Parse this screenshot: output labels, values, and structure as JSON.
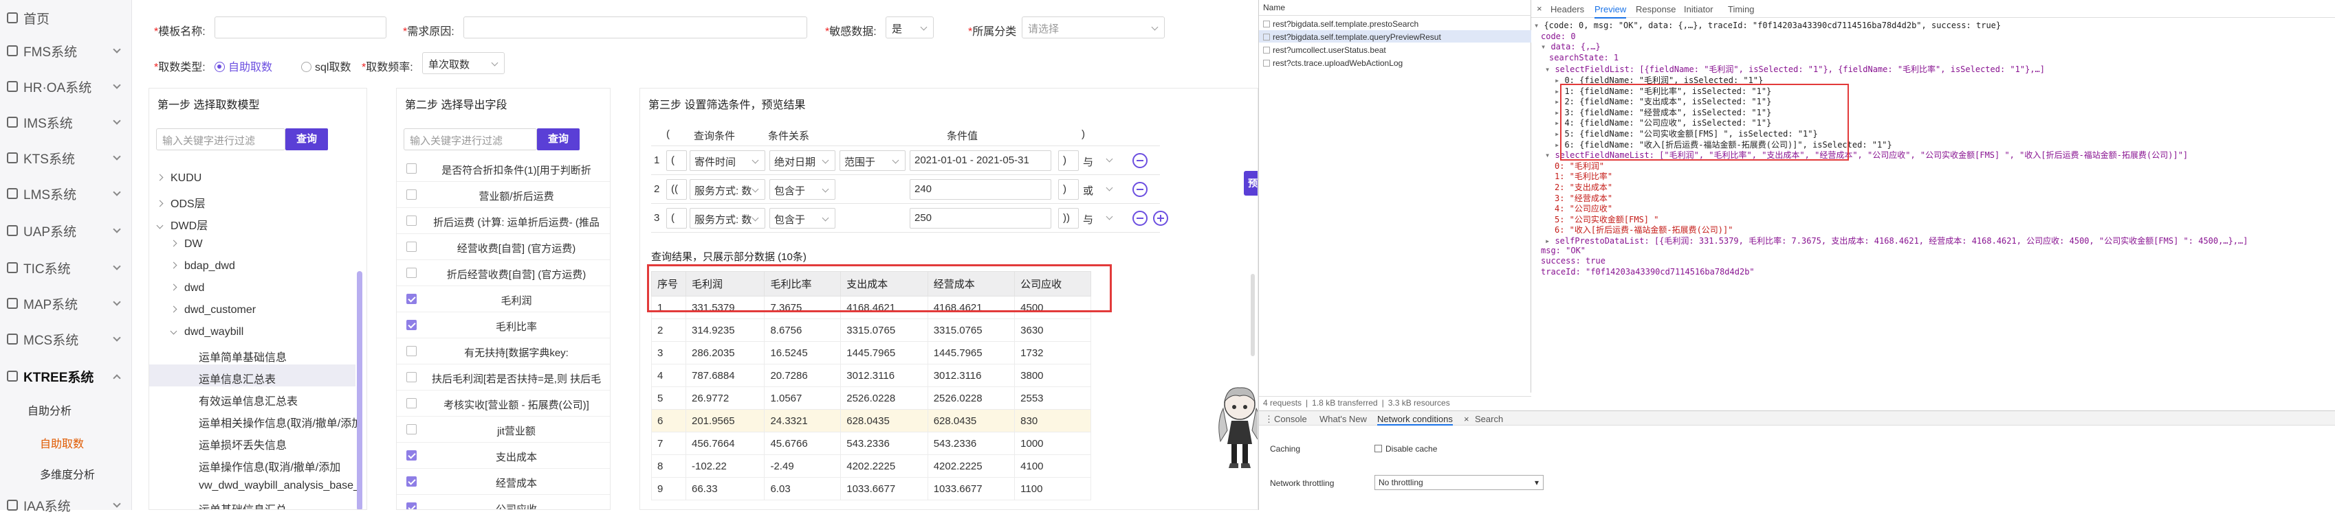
{
  "sidebar": {
    "items": [
      {
        "label": "首页",
        "icon": "home-icon"
      },
      {
        "label": "FMS系统",
        "icon": "module-icon"
      },
      {
        "label": "HR·OA系统",
        "icon": "module-icon"
      },
      {
        "label": "IMS系统",
        "icon": "module-icon"
      },
      {
        "label": "KTS系统",
        "icon": "module-icon"
      },
      {
        "label": "LMS系统",
        "icon": "module-icon"
      },
      {
        "label": "UAP系统",
        "icon": "module-icon"
      },
      {
        "label": "TIC系统",
        "icon": "module-icon"
      },
      {
        "label": "MAP系统",
        "icon": "module-icon"
      },
      {
        "label": "MCS系统",
        "icon": "module-icon"
      },
      {
        "label": "KTREE系统",
        "icon": "module-icon"
      },
      {
        "label": "IAA系统",
        "icon": "module-icon"
      }
    ],
    "sub_items": [
      "自助分析",
      "自助取数",
      "多维度分析"
    ]
  },
  "form": {
    "template_name_label": "模板名称:",
    "demand_reason_label": "需求原因:",
    "sensitive_label": "敏感数据:",
    "sensitive_value": "是",
    "category_label": "所属分类",
    "category_placeholder": "请选择",
    "type_label": "取数类型:",
    "type_option_auto": "自助取数",
    "type_option_sql": "sql取数",
    "freq_label": "取数频率:",
    "freq_value": "单次取数"
  },
  "step1": {
    "title": "第一步 选择取数模型",
    "search_placeholder": "输入关键字进行过滤",
    "search_button": "查询",
    "tree": [
      "KUDU",
      "ODS层",
      "DWD层",
      "DW",
      "bdap_dwd",
      "dwd",
      "dwd_customer",
      "dwd_waybill",
      "运单简单基础信息",
      "运单信息汇总表",
      "有效运单信息汇总表",
      "运单相关操作信息(取消/撤单/添加",
      "运单损坏丢失信息",
      "运单操作信息(取消/撤单/添加",
      "vw_dwd_waybill_analysis_base_t",
      "运单基础信息汇总"
    ]
  },
  "step2": {
    "title": "第二步 选择导出字段",
    "search_placeholder": "输入关键字进行过滤",
    "search_button": "查询",
    "fields": [
      {
        "label": "是否符合折扣条件(1)[用于判断折",
        "checked": false
      },
      {
        "label": "营业额/折后运费",
        "checked": false
      },
      {
        "label": "折后运费 (计算: 运单折后运费- (推品",
        "checked": false
      },
      {
        "label": "经营收费[自营] (官方运费)",
        "checked": false
      },
      {
        "label": "折后经营收费[自营] (官方运费)",
        "checked": false
      },
      {
        "label": "毛利润",
        "checked": true
      },
      {
        "label": "毛利比率",
        "checked": true
      },
      {
        "label": "有无扶持[数据字典key:",
        "checked": false
      },
      {
        "label": "扶后毛利润[若是否扶持=是,则 扶后毛",
        "checked": false
      },
      {
        "label": "考核实收[营业额 - 拓展费(公司)]",
        "checked": false
      },
      {
        "label": "jit营业额",
        "checked": false
      },
      {
        "label": "支出成本",
        "checked": true
      },
      {
        "label": "经营成本",
        "checked": true
      },
      {
        "label": "公司应收",
        "checked": true
      }
    ]
  },
  "step3": {
    "title": "第三步 设置筛选条件，预览结果",
    "headers": [
      "(",
      "查询条件",
      "条件关系",
      "条件值",
      ")"
    ],
    "preview_button": "预览",
    "rows": [
      {
        "num": "1",
        "open": "(",
        "field": "寄件时间",
        "rel": "绝对日期",
        "op": "范围于",
        "value": "2021-01-01 - 2021-05-31",
        "close": ")",
        "logic": "与"
      },
      {
        "num": "2",
        "open": "((",
        "field": "服务方式: 数",
        "rel": "包含于",
        "op": "",
        "value": "240",
        "close": ")",
        "logic": "或"
      },
      {
        "num": "3",
        "open": "(",
        "field": "服务方式: 数",
        "rel": "包含于",
        "op": "",
        "value": "250",
        "close": "))",
        "logic": "与"
      }
    ],
    "result_caption": "查询结果，只展示部分数据 (10条)",
    "columns": [
      "序号",
      "毛利润",
      "毛利比率",
      "支出成本",
      "经营成本",
      "公司应收"
    ],
    "result_rows": [
      [
        "1",
        "331.5379",
        "7.3675",
        "4168.4621",
        "4168.4621",
        "4500"
      ],
      [
        "2",
        "314.9235",
        "8.6756",
        "3315.0765",
        "3315.0765",
        "3630"
      ],
      [
        "3",
        "286.2035",
        "16.5245",
        "1445.7965",
        "1445.7965",
        "1732"
      ],
      [
        "4",
        "787.6884",
        "20.7286",
        "3012.3116",
        "3012.3116",
        "3800"
      ],
      [
        "5",
        "26.9772",
        "1.0567",
        "2526.0228",
        "2526.0228",
        "2553"
      ],
      [
        "6",
        "201.9565",
        "24.3321",
        "628.0435",
        "628.0435",
        "830"
      ],
      [
        "7",
        "456.7664",
        "45.6766",
        "543.2336",
        "543.2336",
        "1000"
      ],
      [
        "8",
        "-102.22",
        "-2.49",
        "4202.2225",
        "4202.2225",
        "4100"
      ],
      [
        "9",
        "66.33",
        "6.03",
        "1033.6677",
        "1033.6677",
        "1100"
      ]
    ]
  },
  "devtools": {
    "name_header": "Name",
    "requests": [
      "rest?bigdata.self.template.prestoSearch",
      "rest?bigdata.self.template.queryPreviewResut",
      "rest?umcollect.userStatus.beat",
      "rest?cts.trace.uploadWebActionLog"
    ],
    "tabs": [
      "Headers",
      "Preview",
      "Response",
      "Initiator",
      "Timing"
    ],
    "active_tab": "Preview",
    "footer": [
      "4 requests",
      "1.8 kB transferred",
      "3.3 kB resources"
    ],
    "drawer_tabs": [
      "Console",
      "What's New",
      "Network conditions",
      "Search"
    ],
    "caching_label": "Caching",
    "disable_cache_label": "Disable cache",
    "throttling_label": "Network throttling",
    "throttling_value": "No throttling",
    "preview_lines": [
      "{code: 0, msg: \"OK\", data: {,…}, traceId: \"f0f14203a43390cd7114516ba78d4d2b\", success: true}",
      "code: 0",
      "data: {,…}",
      "searchState: 1",
      "selectFieldList: [{fieldName: \"毛利润\", isSelected: \"1\"}, {fieldName: \"毛利比率\", isSelected: \"1\"},…]",
      "0: {fieldName: \"毛利润\", isSelected: \"1\"}",
      "1: {fieldName: \"毛利比率\", isSelected: \"1\"}",
      "2: {fieldName: \"支出成本\", isSelected: \"1\"}",
      "3: {fieldName: \"经营成本\", isSelected: \"1\"}",
      "4: {fieldName: \"公司应收\", isSelected: \"1\"}",
      "5: {fieldName: \"公司实收金额[FMS] \", isSelected: \"1\"}",
      "6: {fieldName: \"收入[折后运费-福站金额-拓展费(公司)]\", isSelected: \"1\"}",
      "selectFieldNameList: [\"毛利润\", \"毛利比率\", \"支出成本\", \"经营成本\", \"公司应收\", \"公司实收金额[FMS] \", \"收入[折后运费-福站金额-拓展费(公司)]\"]",
      "0: \"毛利润\"",
      "1: \"毛利比率\"",
      "2: \"支出成本\"",
      "3: \"经营成本\"",
      "4: \"公司应收\"",
      "5: \"公司实收金额[FMS] \"",
      "6: \"收入[折后运费-福站金额-拓展费(公司)]\"",
      "selfPrestoDataList: [{毛利润: 331.5379, 毛利比率: 7.3675, 支出成本: 4168.4621, 经营成本: 4168.4621, 公司应收: 4500, \"公司实收金额[FMS] \": 4500,…},…]",
      "msg: \"OK\"",
      "success: true",
      "traceId: \"f0f14203a43390cd7114516ba78d4d2b\""
    ]
  },
  "colors": {
    "accent": "#5a3fd6",
    "highlight_box": "#e23a3a",
    "active_menu": "#e05a00"
  }
}
